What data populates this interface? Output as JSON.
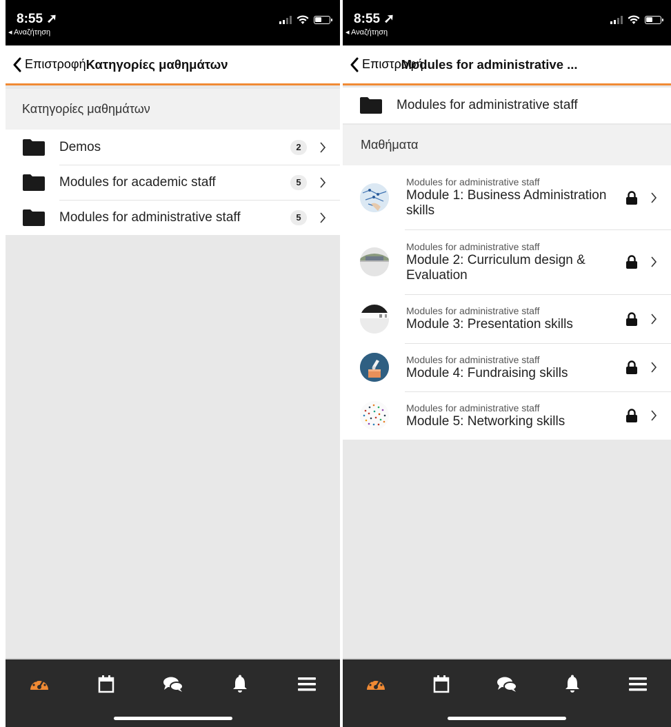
{
  "colors": {
    "accent": "#f08a34",
    "tabbar": "#2b2b2b",
    "statusbar": "#000000"
  },
  "left": {
    "status": {
      "time": "8:55 ➚",
      "back": "◂ Αναζήτηση"
    },
    "nav": {
      "back_label": "Επιστροφή",
      "title": "Κατηγορίες μαθημάτων"
    },
    "section_header": "Κατηγορίες μαθημάτων",
    "categories": [
      {
        "label": "Demos",
        "count": "2"
      },
      {
        "label": "Modules for academic staff",
        "count": "5"
      },
      {
        "label": "Modules for administrative staff",
        "count": "5"
      }
    ]
  },
  "right": {
    "status": {
      "time": "8:55 ➚",
      "back": "◂ Αναζήτηση"
    },
    "nav": {
      "back_label": "Επιστροφή",
      "title": "Modules for administrative ..."
    },
    "folder_label": "Modules for administrative staff",
    "section_header": "Μαθήματα",
    "courses": [
      {
        "category": "Modules for administrative staff",
        "name": "Module 1: Business Administration skills",
        "thumb": "network-map-thumb"
      },
      {
        "category": "Modules for administrative staff",
        "name": "Module 2: Curriculum design & Evaluation",
        "thumb": "building-thumb"
      },
      {
        "category": "Modules for administrative staff",
        "name": "Module 3: Presentation skills",
        "thumb": "room-thumb"
      },
      {
        "category": "Modules for administrative staff",
        "name": "Module 4: Fundraising skills",
        "thumb": "donation-box-thumb"
      },
      {
        "category": "Modules for administrative staff",
        "name": "Module 5: Networking skills",
        "thumb": "dots-network-thumb"
      }
    ]
  },
  "tabs": [
    {
      "icon": "dashboard-icon"
    },
    {
      "icon": "calendar-icon"
    },
    {
      "icon": "messages-icon"
    },
    {
      "icon": "bell-icon"
    },
    {
      "icon": "menu-icon"
    }
  ]
}
